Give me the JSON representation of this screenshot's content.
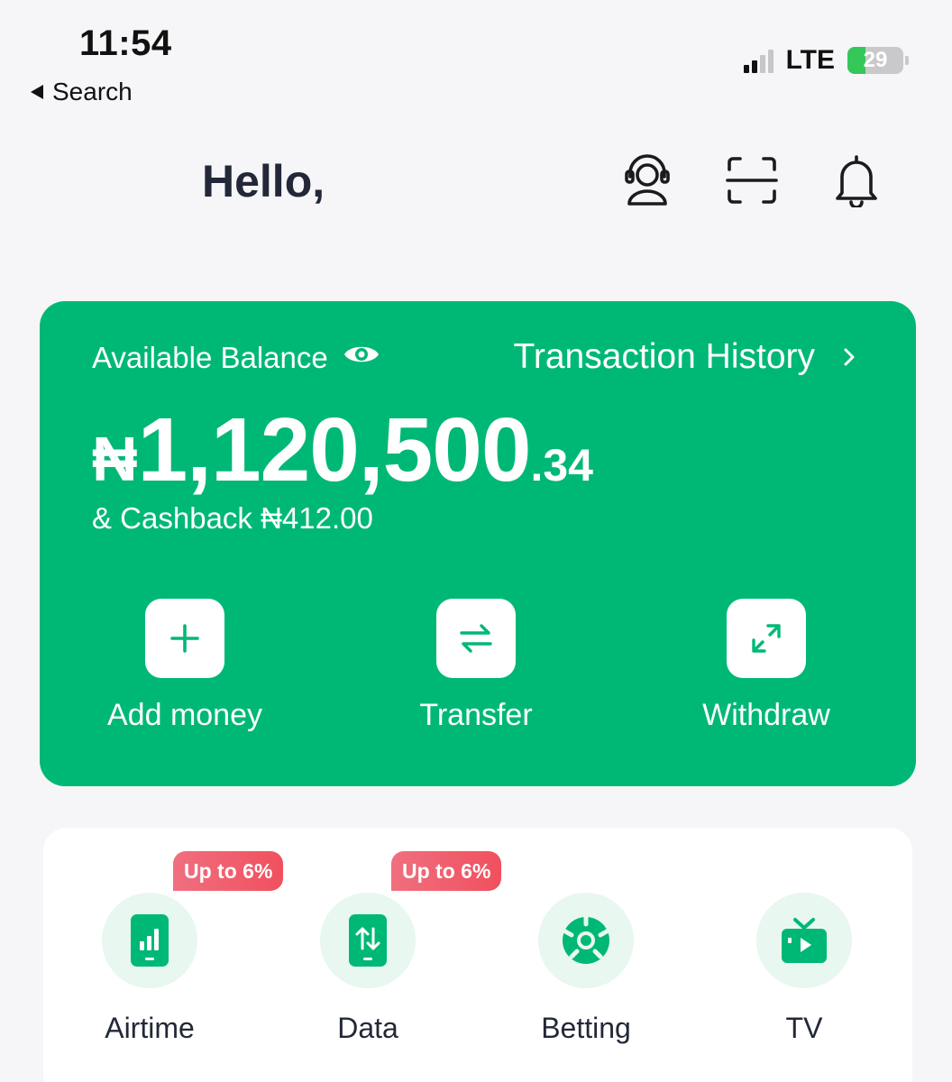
{
  "status_bar": {
    "time": "11:54",
    "back_label": "Search",
    "network": "LTE",
    "battery": "29",
    "battery_color": "#34c759"
  },
  "header": {
    "greeting": "Hello,",
    "icons": [
      "customer-support-icon",
      "scan-icon",
      "notification-bell-icon"
    ]
  },
  "balance_card": {
    "color": "#00b876",
    "label": "Available Balance",
    "history_label": "Transaction History",
    "currency": "₦",
    "amount_main": "1,120,500",
    "amount_decimal": ".34",
    "cashback": "& Cashback ₦412.00",
    "actions": [
      {
        "label": "Add money",
        "icon": "plus-icon"
      },
      {
        "label": "Transfer",
        "icon": "transfer-arrows-icon"
      },
      {
        "label": "Withdraw",
        "icon": "expand-arrows-icon"
      }
    ]
  },
  "services": {
    "items": [
      {
        "label": "Airtime",
        "icon": "phone-signal-icon",
        "badge": "Up to 6%"
      },
      {
        "label": "Data",
        "icon": "phone-data-icon",
        "badge": "Up to 6%"
      },
      {
        "label": "Betting",
        "icon": "soccer-ball-icon",
        "badge": ""
      },
      {
        "label": "TV",
        "icon": "tv-icon",
        "badge": ""
      }
    ]
  }
}
